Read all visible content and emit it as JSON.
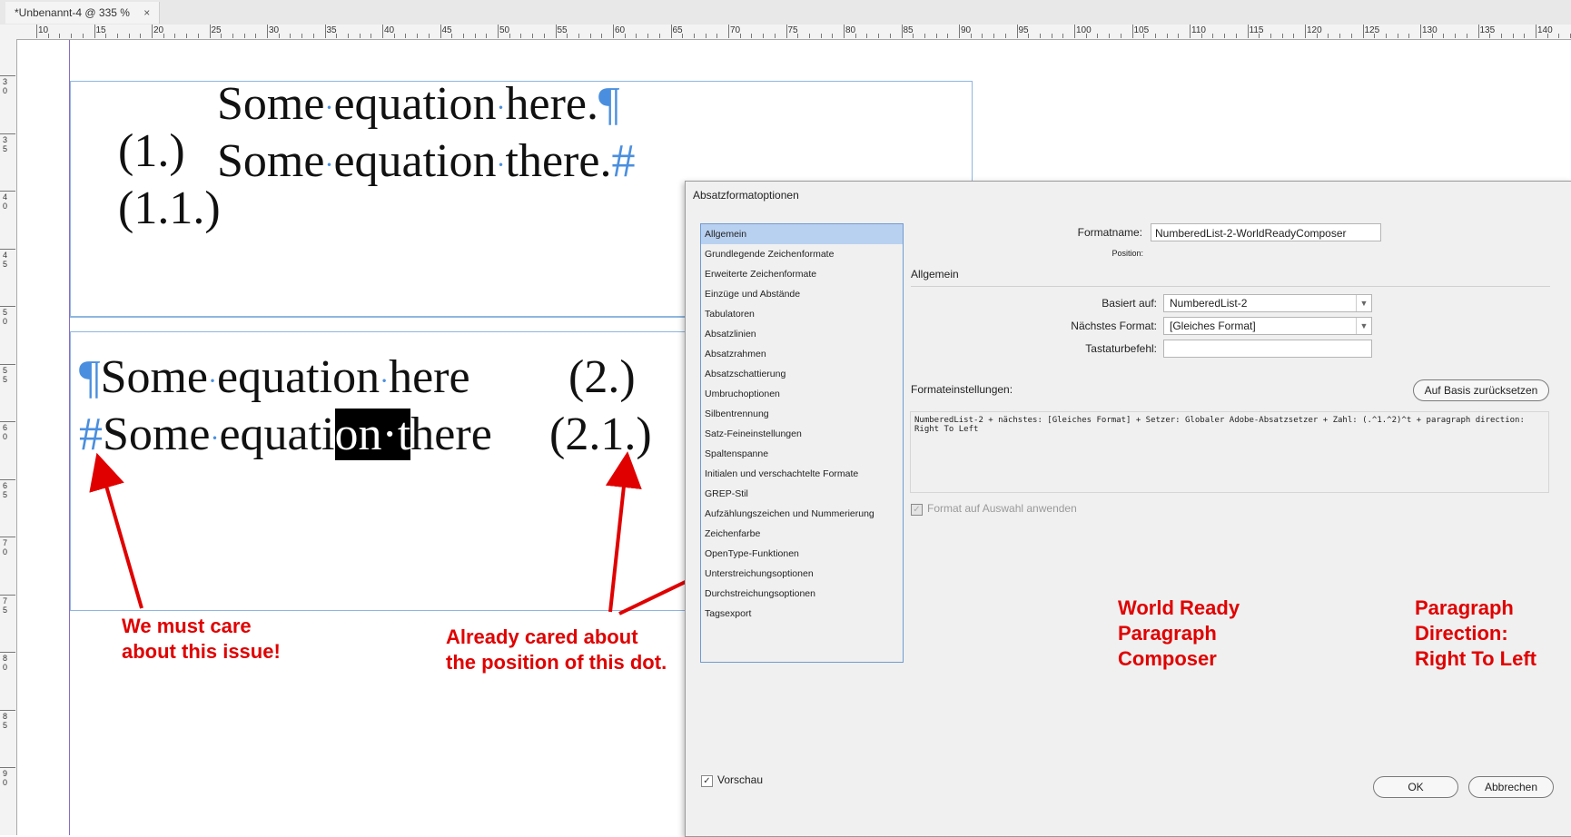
{
  "tab": {
    "title": "*Unbenannt-4 @ 335 %",
    "close": "×"
  },
  "ruler": {
    "h_labels": [
      "10",
      "15",
      "20",
      "25",
      "30",
      "35",
      "40",
      "45",
      "50",
      "55",
      "60",
      "65",
      "70",
      "75",
      "80",
      "85",
      "90",
      "95",
      "100",
      "105",
      "110",
      "115",
      "120",
      "125",
      "130",
      "135",
      "140"
    ],
    "v_labels": [
      "30",
      "35",
      "40",
      "45",
      "50",
      "55",
      "60",
      "65",
      "70",
      "75",
      "80",
      "85",
      "90"
    ]
  },
  "document": {
    "top_frame": {
      "line1": {
        "number": "(1.)",
        "words": [
          "Some",
          "equation",
          "here."
        ],
        "end_mark": "¶"
      },
      "line2": {
        "number": "(1.1.)",
        "words": [
          "Some",
          "equation",
          "there."
        ],
        "end_mark": "#"
      }
    },
    "bottom_frame": {
      "line1": {
        "start_mark": "¶",
        "words": [
          "Some",
          "equation",
          "here"
        ],
        "number": "(2.)"
      },
      "line2": {
        "start_mark": "#",
        "w1": "Some",
        "w2_pre": "equati",
        "sel_a": "on",
        "sel_b": "t",
        "w3_post": "here",
        "number": "(2.1.)"
      }
    }
  },
  "annotations": {
    "a1": "We must care\nabout this issue!",
    "a2": "Already cared about\nthe position of this dot.",
    "a3": "World Ready\nParagraph\nComposer",
    "a4": "Paragraph\nDirection:\nRight To Left",
    "color": "#e00000"
  },
  "dialog": {
    "title": "Absatzformatoptionen",
    "categories": [
      "Allgemein",
      "Grundlegende Zeichenformate",
      "Erweiterte Zeichenformate",
      "Einzüge und Abstände",
      "Tabulatoren",
      "Absatzlinien",
      "Absatzrahmen",
      "Absatzschattierung",
      "Umbruchoptionen",
      "Silbentrennung",
      "Satz-Feineinstellungen",
      "Spaltenspanne",
      "Initialen und verschachtelte Formate",
      "GREP-Stil",
      "Aufzählungszeichen und Nummerierung",
      "Zeichenfarbe",
      "OpenType-Funktionen",
      "Unterstreichungsoptionen",
      "Durchstreichungsoptionen",
      "Tagsexport"
    ],
    "format_name_label": "Formatname:",
    "format_name_value": "NumberedList-2-WorldReadyComposer",
    "position_label": "Position:",
    "section_title": "Allgemein",
    "based_on_label": "Basiert auf:",
    "based_on_value": "NumberedList-2",
    "next_format_label": "Nächstes Format:",
    "next_format_value": "[Gleiches Format]",
    "shortcut_label": "Tastaturbefehl:",
    "shortcut_value": "",
    "settings_label": "Formateinstellungen:",
    "reset_button": "Auf Basis zurücksetzen",
    "description": "NumberedList-2 + nächstes: [Gleiches Format] + Setzer: Globaler Adobe-Absatzsetzer + Zahl: (.^1.^2)^t + paragraph direction: Right To Left",
    "apply_label": "Format auf Auswahl anwenden",
    "preview_label": "Vorschau",
    "ok_button": "OK",
    "cancel_button": "Abbrechen"
  }
}
